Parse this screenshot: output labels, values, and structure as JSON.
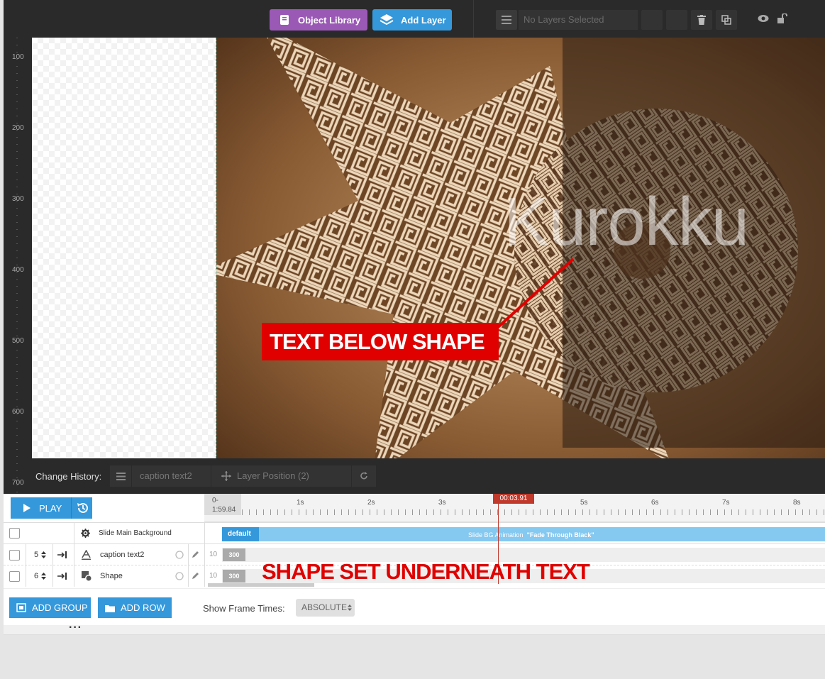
{
  "toolbar": {
    "object_library": "Object Library",
    "add_layer": "Add Layer",
    "layers_selected": "No Layers Selected",
    "menu_icon": "menu-icon",
    "trash_icon": "trash-icon",
    "eye_icon": "eye-icon",
    "lock_icon": "unlock-icon"
  },
  "ruler": {
    "marks": [
      "100",
      "200",
      "300",
      "400",
      "500",
      "600",
      "700"
    ]
  },
  "canvas": {
    "headline_text": "Kurokku",
    "annotation_label": "TEXT BELOW SHAPE"
  },
  "history": {
    "label": "Change History:",
    "entry1": "caption text2",
    "entry2": "Layer Position (2)"
  },
  "timeline": {
    "play_label": "PLAY",
    "start_top": "0-",
    "start_bottom": "1:59.84",
    "playhead_time": "00:03.91",
    "ticks": [
      "1s",
      "2s",
      "3s",
      "4s",
      "5s",
      "6s",
      "7s",
      "8s"
    ],
    "main_bg": {
      "label": "Slide Main Background",
      "default_label": "default",
      "anim_prefix": "Slide BG Animation",
      "anim_name": "\"Fade Through Black\""
    },
    "layers": [
      {
        "order": "5",
        "name": "caption text2",
        "start": "10",
        "duration": "300",
        "icon": "text-icon"
      },
      {
        "order": "6",
        "name": "Shape",
        "start": "10",
        "duration": "300",
        "icon": "shape-icon"
      }
    ],
    "annotation": "SHAPE SET UNDERNEATH TEXT"
  },
  "bottom": {
    "add_group": "ADD GROUP",
    "add_row": "ADD ROW",
    "frame_times_label": "Show Frame Times:",
    "frame_times_value": "ABSOLUTE"
  },
  "colors": {
    "accent_blue": "#3498db",
    "accent_purple": "#9b59b6",
    "annotation_red": "#e00000",
    "playhead_red": "#c0392b"
  }
}
